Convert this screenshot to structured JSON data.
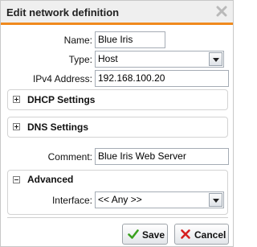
{
  "dialog": {
    "title": "Edit network definition"
  },
  "form": {
    "name_label": "Name:",
    "name_value": "Blue Iris",
    "type_label": "Type:",
    "type_value": "Host",
    "ipv4_label": "IPv4 Address:",
    "ipv4_value": "192.168.100.20",
    "comment_label": "Comment:",
    "comment_value": "Blue Iris Web Server"
  },
  "sections": {
    "dhcp_title": "DHCP Settings",
    "dns_title": "DNS Settings",
    "advanced_title": "Advanced",
    "interface_label": "Interface:",
    "interface_value": "<< Any >>"
  },
  "buttons": {
    "save_label": "Save",
    "cancel_label": "Cancel"
  },
  "colors": {
    "accent": "#f08a1e",
    "save_icon": "#3aa11f",
    "cancel_icon": "#d62020"
  },
  "icons": {
    "close": "close-icon",
    "dhcp_toggle": "expand-plus-icon",
    "dns_toggle": "expand-plus-icon",
    "advanced_toggle": "collapse-minus-icon",
    "save": "checkmark-icon",
    "cancel": "x-icon"
  }
}
